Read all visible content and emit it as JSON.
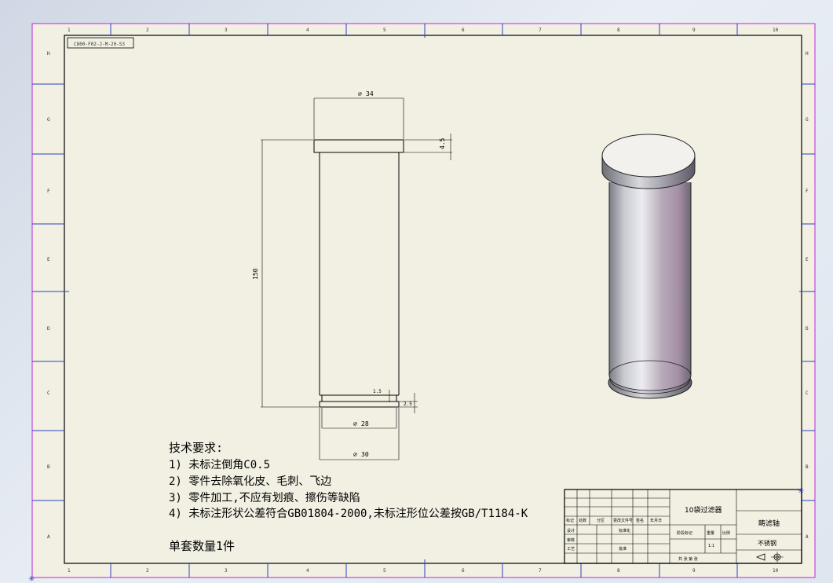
{
  "drawing_number": "C800-F02-J-M-20-S3",
  "zone_numbers": [
    "1",
    "2",
    "3",
    "4",
    "5",
    "6",
    "7",
    "8",
    "9",
    "10"
  ],
  "zone_letters": [
    "H",
    "G",
    "F",
    "E",
    "D",
    "C",
    "B",
    "A"
  ],
  "dimensions": {
    "top_diameter": "34",
    "flange_height": "4.5",
    "overall_length": "150",
    "groove_diameter": "28",
    "groove_width": "1.5",
    "bottom_diameter": "30",
    "bottom_step": "2.5"
  },
  "notes": {
    "title": "技术要求:",
    "items": [
      "1) 未标注倒角C0.5",
      "2) 零件去除氧化皮、毛刺、飞边",
      "3) 零件加工,不应有划痕、擦伤等缺陷",
      "4) 未标注形状公差符合GB01804-2000,未标注形位公差按GB/T1184-K"
    ],
    "quantity": "单套数量1件"
  },
  "title_block": {
    "assembly_name": "10袋过滤器",
    "part_name": "畴滤轴",
    "material": "不锈钢",
    "row_labels": [
      "标记",
      "处数",
      "分区",
      "更改文件号",
      "签名",
      "年月日"
    ],
    "design_label": "设计",
    "check_label": "审核",
    "process_label": "工艺",
    "std_label": "标准化",
    "approve_label": "批准",
    "stage_label": "阶段标记",
    "weight_label": "重量",
    "scale_label": "比例",
    "scale_value": "1:1",
    "sheet_label": "共 张 第 张"
  },
  "colors": {
    "sheet": "#f2f0e3",
    "frame": "#000000",
    "zone_marker": "#2b3fbf",
    "outer_border": "#c026d3"
  }
}
